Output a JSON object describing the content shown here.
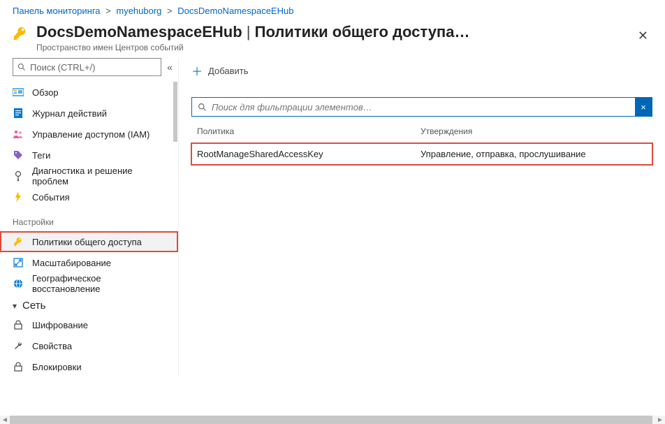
{
  "breadcrumb": {
    "dashboard": "Панель мониторинга",
    "org": "myehuborg",
    "resource": "DocsDemoNamespaceEHub",
    "sep": ">"
  },
  "header": {
    "name": "DocsDemoNamespaceEHub",
    "pipe": " | ",
    "section": "Политики общего доступа",
    "ellipsis": "…",
    "subtitle": "Пространство имен Центров событий"
  },
  "sidebar": {
    "search_placeholder": "Поиск (CTRL+/)",
    "items": {
      "overview": "Обзор",
      "activity": "Журнал действий",
      "iam": "Управление доступом (IAM)",
      "tags": "Теги",
      "diag": "Диагностика и решение проблем",
      "events": "События"
    },
    "settings_heading": "Настройки",
    "settings": {
      "sas": "Политики общего доступа",
      "scale": "Масштабирование",
      "geo": "Географическое восстановление"
    },
    "net_heading": "Сеть",
    "net": {
      "encrypt": "Шифрование",
      "props": "Свойства",
      "locks": "Блокировки"
    }
  },
  "toolbar": {
    "add": "Добавить"
  },
  "filter": {
    "placeholder": "Поиск для фильтрации элементов…",
    "clear": "×"
  },
  "table": {
    "col_policy": "Политика",
    "col_claims": "Утверждения",
    "rows": [
      {
        "name": "RootManageSharedAccessKey",
        "claims": "Управление, отправка, прослушивание"
      }
    ]
  }
}
